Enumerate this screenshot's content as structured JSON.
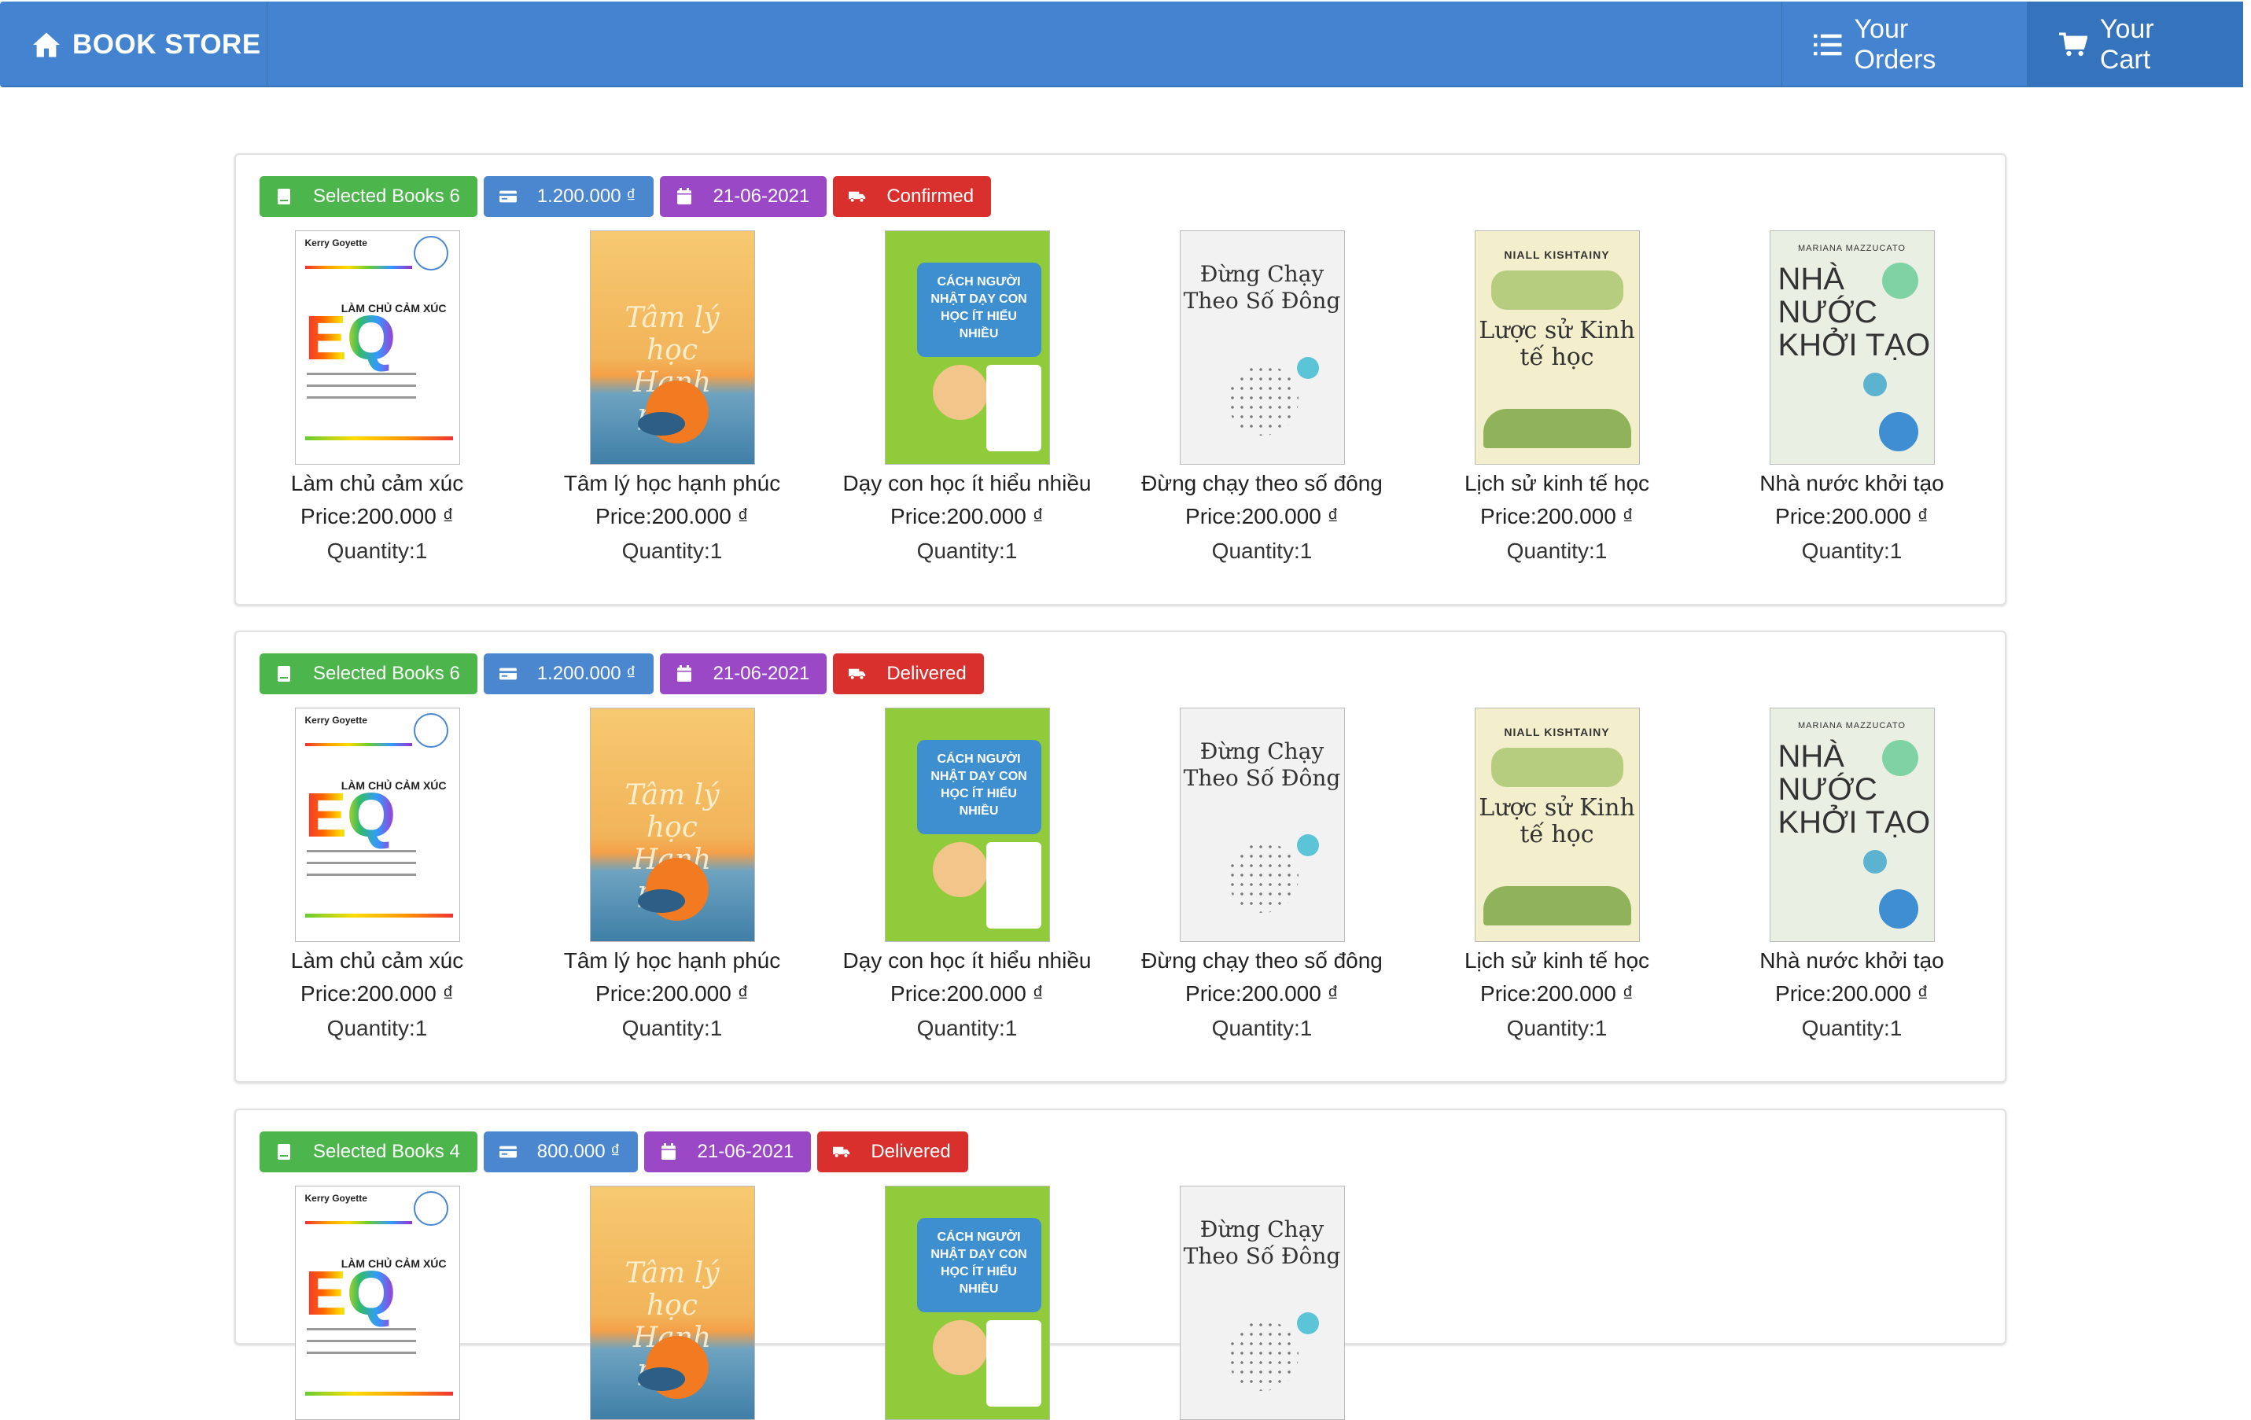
{
  "nav": {
    "brand": "BOOK STORE",
    "orders_label": "Your Orders",
    "cart_label": "Your Cart"
  },
  "orders": [
    {
      "selected": "Selected Books 6",
      "total": "1.200.000 ₫",
      "date": "21-06-2021",
      "status": "Confirmed",
      "books": [
        {
          "title": "Làm chủ cảm xúc",
          "price": "Price:200.000 ₫",
          "qty": "Quantity:1"
        },
        {
          "title": "Tâm lý học hạnh phúc",
          "price": "Price:200.000 ₫",
          "qty": "Quantity:1"
        },
        {
          "title": "Dạy con học ít hiểu nhiều",
          "price": "Price:200.000 ₫",
          "qty": "Quantity:1"
        },
        {
          "title": "Đừng chạy theo số đông",
          "price": "Price:200.000 ₫",
          "qty": "Quantity:1"
        },
        {
          "title": "Lịch sử kinh tế học",
          "price": "Price:200.000 ₫",
          "qty": "Quantity:1"
        },
        {
          "title": "Nhà nước khởi tạo",
          "price": "Price:200.000 ₫",
          "qty": "Quantity:1"
        }
      ]
    },
    {
      "selected": "Selected Books 6",
      "total": "1.200.000 ₫",
      "date": "21-06-2021",
      "status": "Delivered",
      "books": [
        {
          "title": "Làm chủ cảm xúc",
          "price": "Price:200.000 ₫",
          "qty": "Quantity:1"
        },
        {
          "title": "Tâm lý học hạnh phúc",
          "price": "Price:200.000 ₫",
          "qty": "Quantity:1"
        },
        {
          "title": "Dạy con học ít hiểu nhiều",
          "price": "Price:200.000 ₫",
          "qty": "Quantity:1"
        },
        {
          "title": "Đừng chạy theo số đông",
          "price": "Price:200.000 ₫",
          "qty": "Quantity:1"
        },
        {
          "title": "Lịch sử kinh tế học",
          "price": "Price:200.000 ₫",
          "qty": "Quantity:1"
        },
        {
          "title": "Nhà nước khởi tạo",
          "price": "Price:200.000 ₫",
          "qty": "Quantity:1"
        }
      ]
    },
    {
      "selected": "Selected Books 4",
      "total": "800.000 ₫",
      "date": "21-06-2021",
      "status": "Delivered"
    }
  ],
  "covers": {
    "eq_author": "Kerry Goyette",
    "eq_big": "EQ",
    "eq_side": "LÀM CHỦ CẢM XÚC",
    "tam_title": "Tâm lý học Hạnh phúc",
    "day_title": "CÁCH NGƯỜI NHẬT DẠY CON HỌC ÍT HIỂU NHIỀU",
    "dung_title": "Đừng Chạy Theo Số Đông",
    "luoc_author": "NIALL KISHTAINY",
    "luoc_title": "Lược sử Kinh tế học",
    "nha_author": "MARIANA MAZZUCATO",
    "nha_title": "NHÀ NƯỚC KHỞI TẠO"
  }
}
